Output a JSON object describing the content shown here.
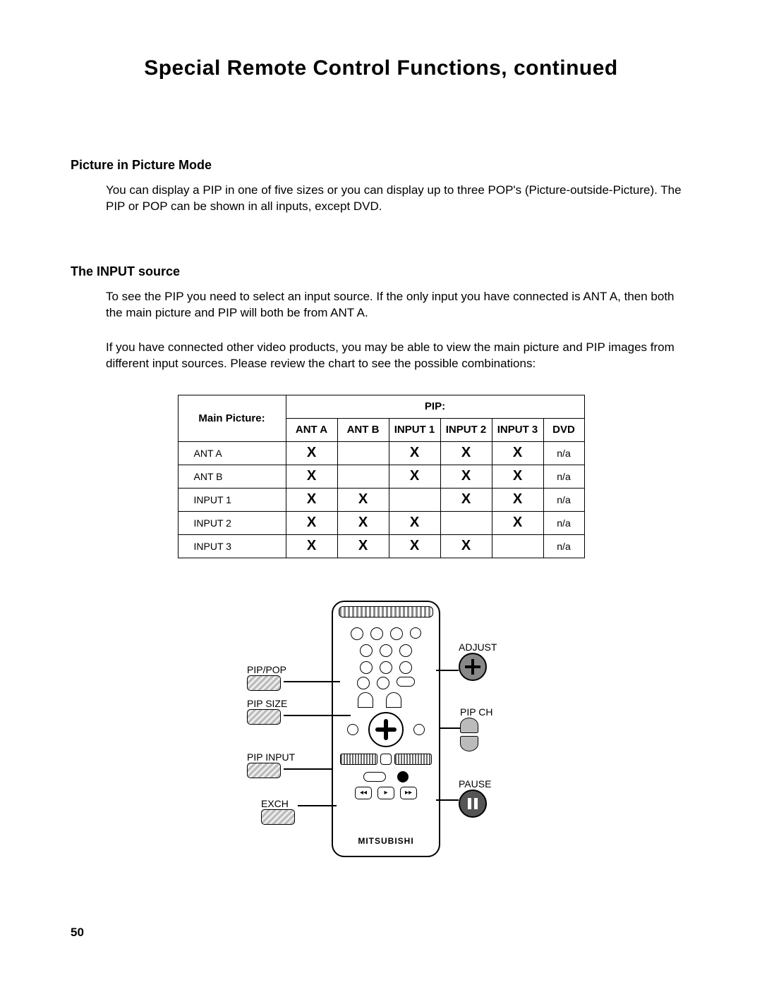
{
  "title": "Special Remote Control Functions, continued",
  "sections": {
    "pip_mode": {
      "heading": "Picture in Picture Mode",
      "body": "You can display a PIP in one of five sizes or you can display up to three POP's (Picture-outside-Picture). The PIP or POP can be shown in all inputs, except DVD."
    },
    "input_source": {
      "heading": "The INPUT source",
      "body1": "To see the PIP you need to select an input source. If the only input you have connected is ANT A, then both the main picture and PIP will both be from ANT A.",
      "body2": "If you have connected other video products, you may be able to view the main picture and PIP images from different input sources. Please review the chart to see the possible combinations:"
    }
  },
  "chart_data": {
    "type": "table",
    "title": "PIP input combination chart",
    "corner_label": "Main Picture:",
    "col_group_label": "PIP:",
    "columns": [
      "ANT A",
      "ANT B",
      "INPUT 1",
      "INPUT 2",
      "INPUT 3",
      "DVD"
    ],
    "rows": [
      {
        "label": "ANT A",
        "cells": [
          "X",
          "",
          "X",
          "X",
          "X",
          "n/a"
        ]
      },
      {
        "label": "ANT B",
        "cells": [
          "X",
          "",
          "X",
          "X",
          "X",
          "n/a"
        ]
      },
      {
        "label": "INPUT 1",
        "cells": [
          "X",
          "X",
          "",
          "X",
          "X",
          "n/a"
        ]
      },
      {
        "label": "INPUT 2",
        "cells": [
          "X",
          "X",
          "X",
          "",
          "X",
          "n/a"
        ]
      },
      {
        "label": "INPUT 3",
        "cells": [
          "X",
          "X",
          "X",
          "X",
          "",
          "n/a"
        ]
      }
    ]
  },
  "diagram": {
    "brand": "MITSUBISHI",
    "callouts": {
      "pip_pop": "PIP/POP",
      "pip_size": "PIP SIZE",
      "pip_input": "PIP INPUT",
      "exch": "EXCH",
      "adjust": "ADJUST",
      "pip_ch": "PIP CH",
      "pause": "PAUSE"
    }
  },
  "page_number": "50"
}
